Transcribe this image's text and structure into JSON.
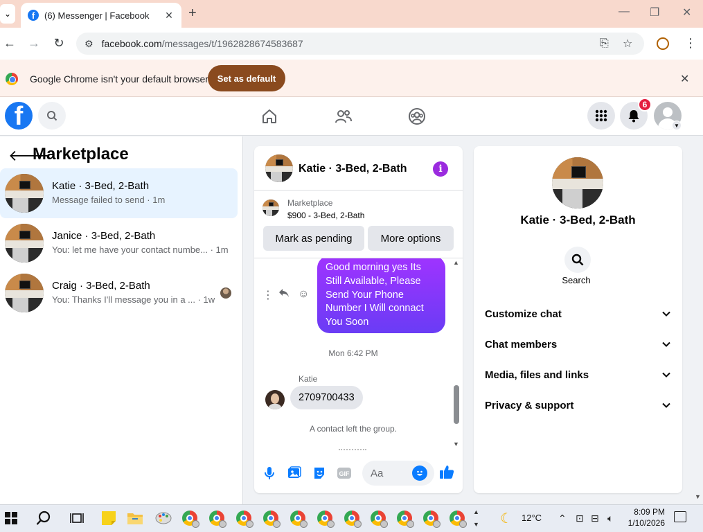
{
  "browser": {
    "tab_title": "(6) Messenger | Facebook",
    "url_host": "facebook.com",
    "url_path": "/messages/t/1962828674583687",
    "infobar_text": "Google Chrome isn't your default browser",
    "set_default_label": "Set as default"
  },
  "header": {
    "notification_count": "6",
    "brand_color": "#1877f2"
  },
  "sidebar": {
    "title": "Marketplace",
    "conversations": [
      {
        "name": "Katie · 3-Bed, 2-Bath",
        "snippet": "Message failed to send · 1m",
        "active": true
      },
      {
        "name": "Janice · 3-Bed, 2-Bath",
        "snippet": "You: let me have your contact numbe... · 1m",
        "active": false
      },
      {
        "name": "Craig · 3-Bed, 2-Bath",
        "snippet": "You: Thanks I'll message you in a ... · 1w",
        "active": false
      }
    ]
  },
  "chat": {
    "title": "Katie · 3-Bed, 2-Bath",
    "listing_label": "Marketplace",
    "listing_price": "$900 - 3-Bed, 2-Bath",
    "mark_pending_label": "Mark as pending",
    "more_options_label": "More options",
    "outgoing_message": "Good morning yes Its Still Available, Please Send Your Phone Number I Will connact You Soon",
    "timestamp": "Mon 6:42 PM",
    "incoming_sender": "Katie",
    "incoming_message": "2709700433",
    "system_note": "A contact left the group.",
    "composer_placeholder": "Aa",
    "accent_color": "#0a7cff"
  },
  "details": {
    "title": "Katie · 3-Bed, 2-Bath",
    "search_label": "Search",
    "sections": [
      "Customize chat",
      "Chat members",
      "Media, files and links",
      "Privacy & support"
    ]
  },
  "taskbar": {
    "temperature": "12°C",
    "time": "8:09 PM",
    "date": "1/10/2026"
  }
}
